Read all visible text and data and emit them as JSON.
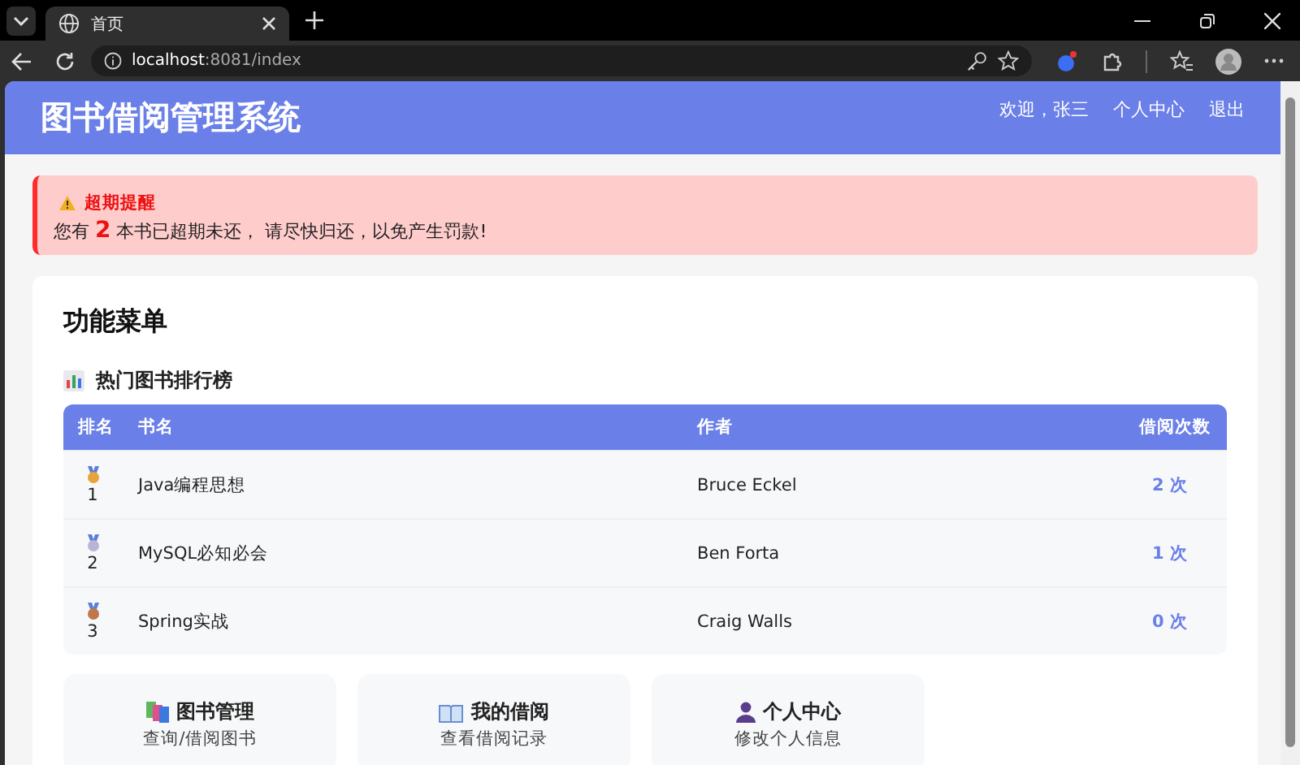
{
  "browser": {
    "tab_title": "首页",
    "url_host": "localhost",
    "url_path": ":8081/index"
  },
  "header": {
    "title": "图书借阅管理系统",
    "nav": [
      "欢迎，张三",
      "个人中心",
      "退出"
    ]
  },
  "alert": {
    "title": "超期提醒",
    "prefix": "您有",
    "count": "2",
    "suffix": "本书已超期未还， 请尽快归还，以免产生罚款!"
  },
  "menu": {
    "title": "功能菜单",
    "ranking_title": "热门图书排行榜",
    "table": {
      "columns": [
        "排名",
        "书名",
        "作者",
        "借阅次数"
      ],
      "rows": [
        {
          "rank": "1",
          "title": "Java编程思想",
          "author": "Bruce Eckel",
          "count": "2 次",
          "color": "#e8a33a"
        },
        {
          "rank": "2",
          "title": "MySQL必知必会",
          "author": "Ben Forta",
          "count": "1 次",
          "color": "#b9b4d6"
        },
        {
          "rank": "3",
          "title": "Spring实战",
          "author": "Craig Walls",
          "count": "0 次",
          "color": "#c0784a"
        }
      ]
    },
    "cards": [
      {
        "kind": "books",
        "title": "图书管理",
        "subtitle": "查询/借阅图书"
      },
      {
        "kind": "borrow",
        "title": "我的借阅",
        "subtitle": "查看借阅记录"
      },
      {
        "kind": "profile",
        "title": "个人中心",
        "subtitle": "修改个人信息"
      }
    ]
  }
}
